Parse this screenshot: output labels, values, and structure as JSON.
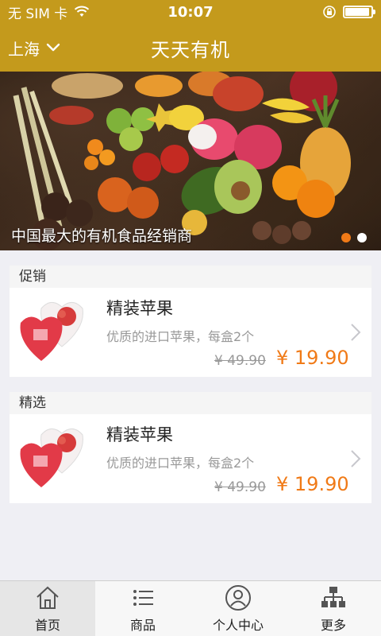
{
  "status_bar": {
    "carrier": "无 SIM 卡",
    "time": "10:07",
    "battery_level": 0.95,
    "icons": [
      "wifi-icon",
      "orientation-lock-icon",
      "battery-icon"
    ]
  },
  "navbar": {
    "city": "上海",
    "title": "天天有机"
  },
  "banner": {
    "caption": "中国最大的有机食品经销商",
    "page_count": 2,
    "active_page": 1
  },
  "sections": [
    {
      "label": "促销",
      "product": {
        "name": "精装苹果",
        "description": "优质的进口苹果，每盒2个",
        "original_price": "¥ 49.90",
        "price": "¥  19.90"
      }
    },
    {
      "label": "精选",
      "product": {
        "name": "精装苹果",
        "description": "优质的进口苹果，每盒2个",
        "original_price": "¥ 49.90",
        "price": "¥  19.90"
      }
    }
  ],
  "tabbar": {
    "tabs": [
      {
        "label": "首页",
        "icon": "home-icon",
        "active": true
      },
      {
        "label": "商品",
        "icon": "list-icon",
        "active": false
      },
      {
        "label": "个人中心",
        "icon": "user-icon",
        "active": false
      },
      {
        "label": "更多",
        "icon": "sitemap-icon",
        "active": false
      }
    ]
  },
  "colors": {
    "nav_background": "#c49a1c",
    "price": "#f07a17",
    "page_background": "#efeff4"
  }
}
